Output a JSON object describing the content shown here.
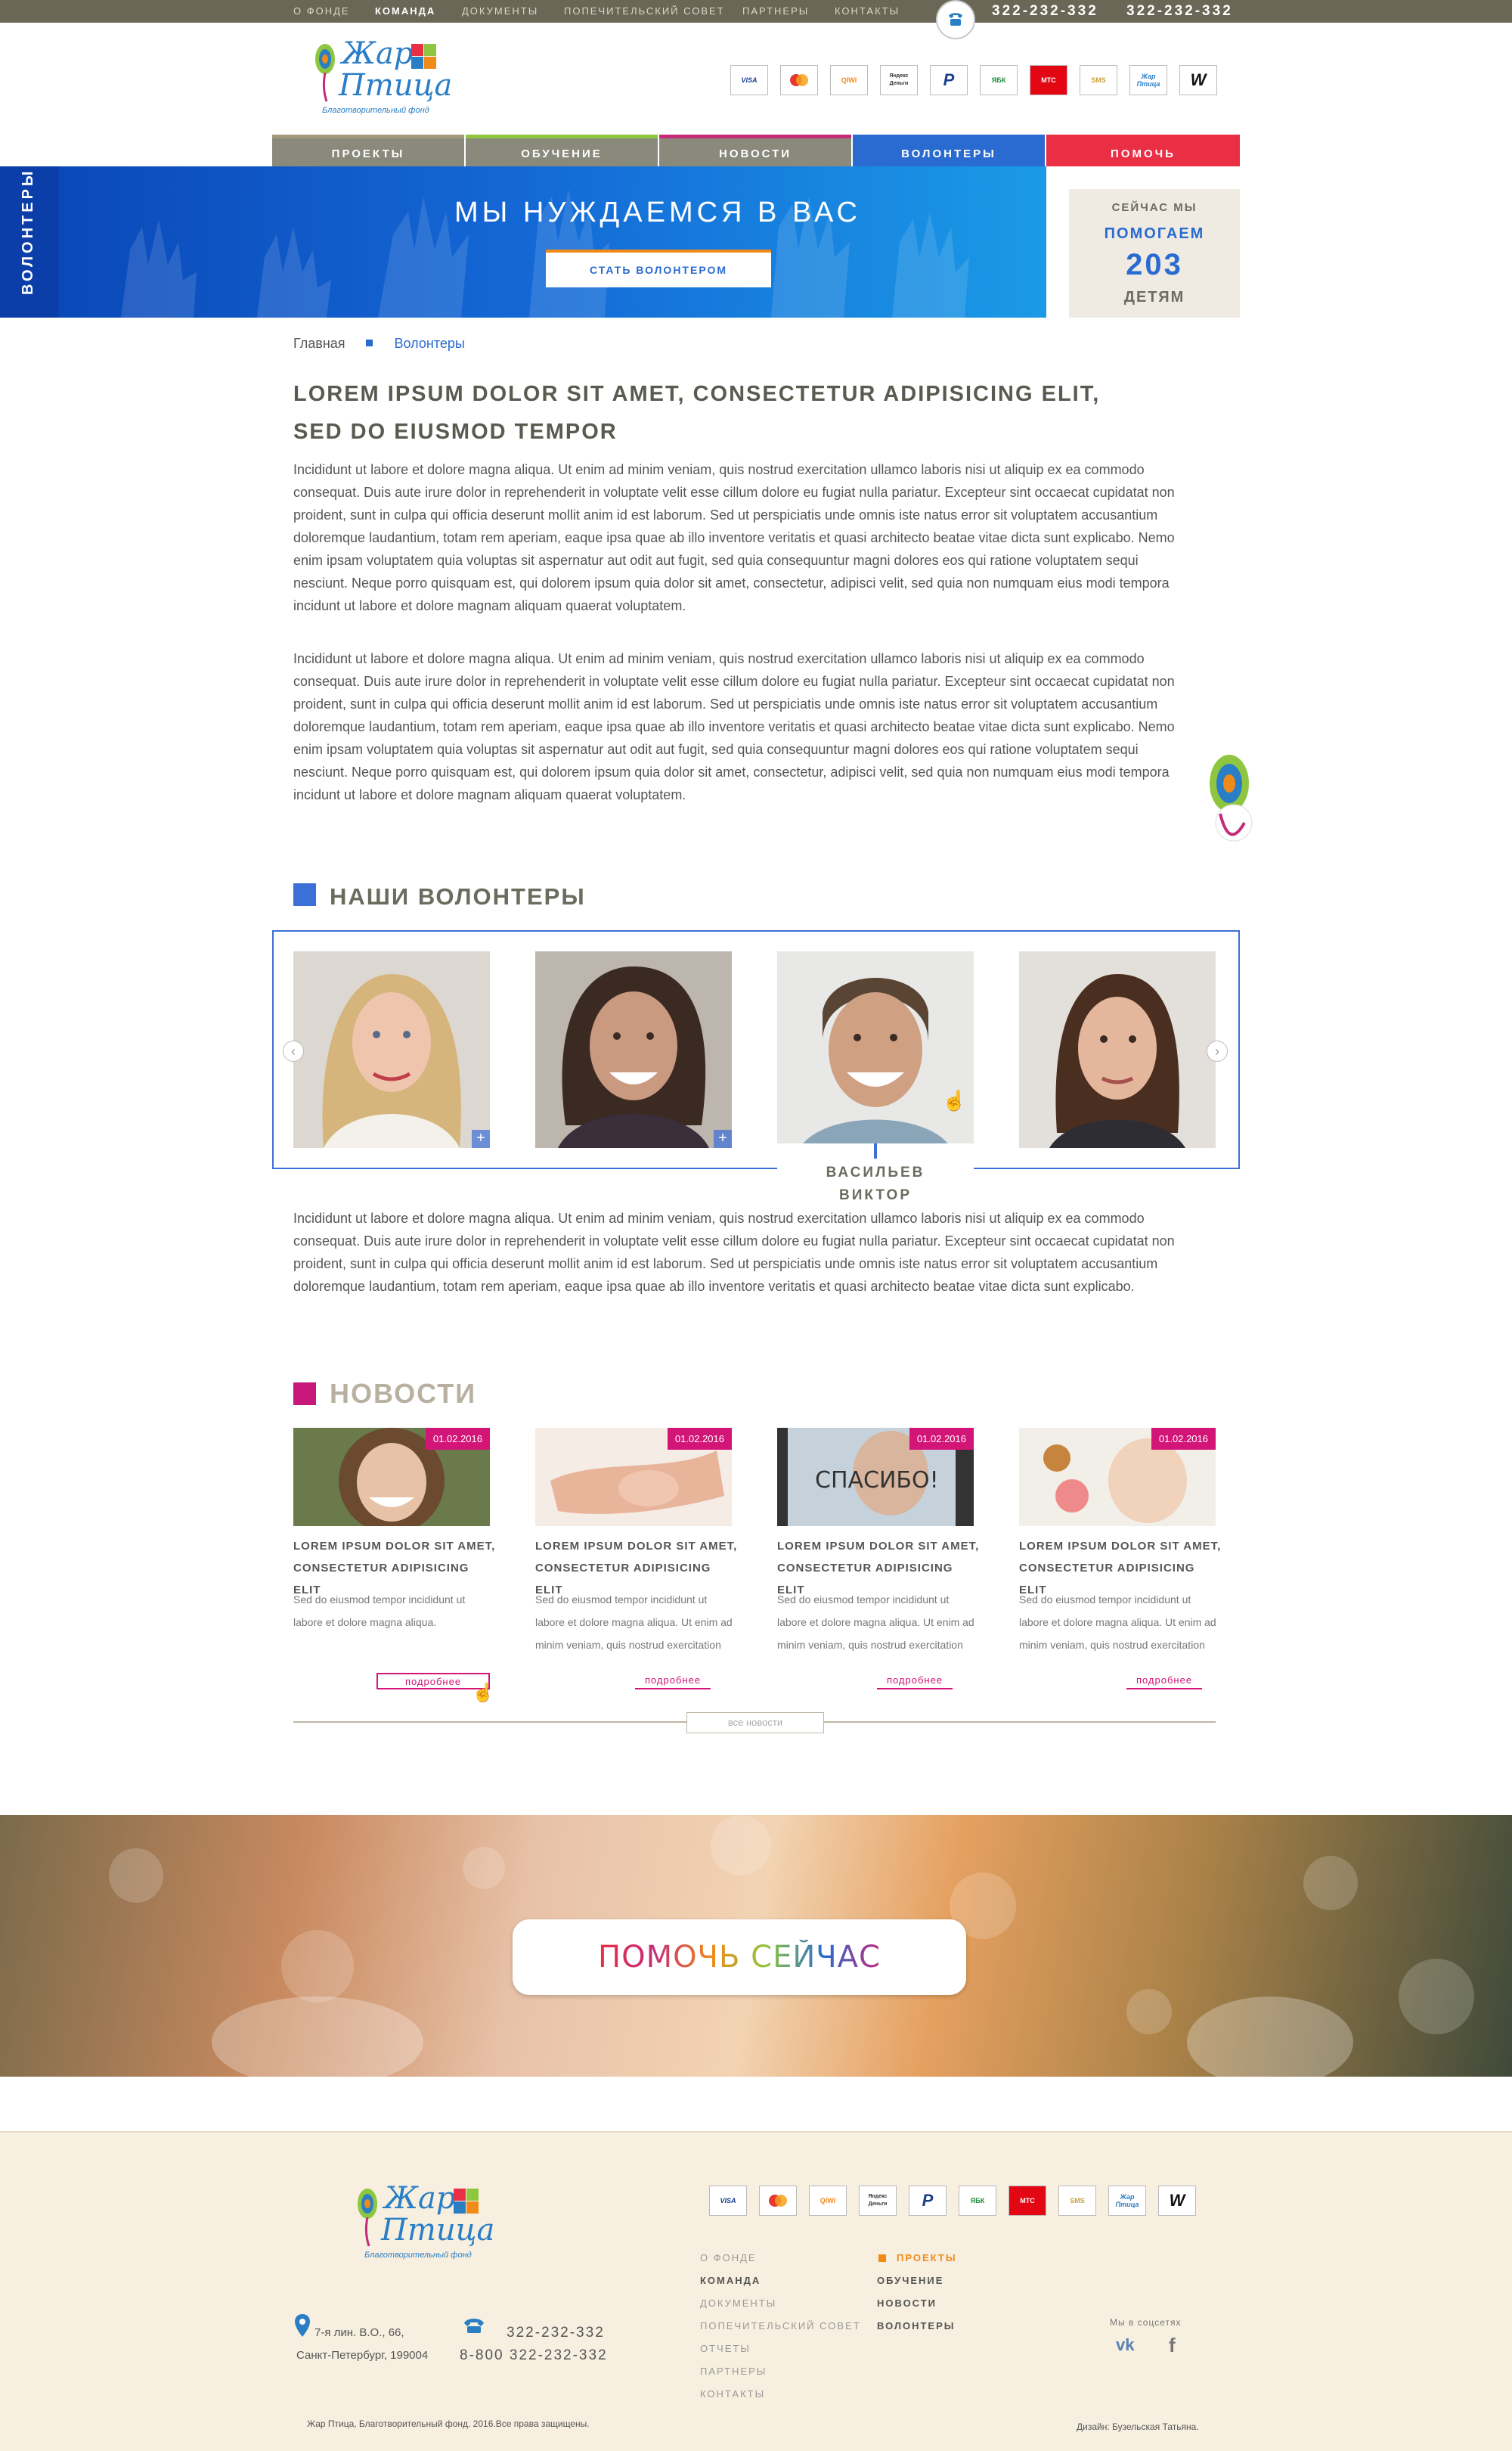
{
  "topnav": {
    "items": [
      "О ФОНДЕ",
      "КОМАНДА",
      "ДОКУМЕНТЫ",
      "ПОПЕЧИТЕЛЬСКИЙ СОВЕТ",
      "ПАРТНЕРЫ",
      "КОНТАКТЫ"
    ],
    "active": "КОМАНДА",
    "phone1": "322-232-332",
    "phone2": "322-232-332"
  },
  "logo": {
    "line1": "Жар",
    "line2": "Птица",
    "subtitle": "Благотворительный фонд"
  },
  "payments": [
    "VISA",
    "Maestro",
    "QIWI",
    "Яндекс Деньги",
    "PayPal",
    "ЯБК",
    "МТС",
    "SMS",
    "Жар Птица",
    "WebMoney"
  ],
  "mainnav": [
    {
      "label": "ПРОЕКТЫ",
      "color": "#8a8a7c",
      "border": "#a39a7a"
    },
    {
      "label": "ОБУЧЕНИЕ",
      "color": "#8a8a7c",
      "border": "#8ec63f"
    },
    {
      "label": "НОВОСТИ",
      "color": "#8a8a7c",
      "border": "#c42c7a"
    },
    {
      "label": "ВОЛОНТЕРЫ",
      "color": "#2a6bd1",
      "border": "#2a6bd1"
    },
    {
      "label": "ПОМОЧЬ",
      "color": "#ea2f45",
      "border": "#ea2f45"
    }
  ],
  "hero": {
    "side_label": "ВОЛОНТЕРЫ",
    "title": "МЫ НУЖДАЕМСЯ В ВАС",
    "button": "СТАТЬ ВОЛОНТЕРОМ"
  },
  "stats": {
    "line1": "СЕЙЧАС МЫ",
    "line2": "ПОМОГАЕМ",
    "number": "203",
    "line3": "ДЕТЯМ"
  },
  "breadcrumb": {
    "home": "Главная",
    "current": "Волонтеры"
  },
  "article": {
    "title_line1": "LOREM IPSUM DOLOR SIT AMET, CONSECTETUR ADIPISICING ELIT,",
    "title_line2": "SED DO EIUSMOD TEMPOR",
    "para1": "Incididunt ut labore et dolore magna aliqua. Ut enim ad minim veniam, quis nostrud exercitation ullamco laboris nisi ut aliquip ex ea commodo consequat. Duis aute irure dolor in reprehenderit in voluptate velit esse cillum dolore eu fugiat nulla pariatur. Excepteur sint occaecat cupidatat non proident, sunt in culpa qui officia deserunt mollit anim id est laborum. Sed ut perspiciatis unde omnis iste natus error sit voluptatem accusantium doloremque laudantium, totam rem aperiam, eaque ipsa quae ab illo inventore veritatis et quasi architecto beatae vitae dicta sunt explicabo. Nemo enim ipsam voluptatem quia voluptas sit aspernatur aut odit aut fugit, sed quia consequuntur magni dolores eos qui ratione voluptatem sequi nesciunt. Neque porro quisquam est, qui dolorem ipsum quia dolor sit amet, consectetur, adipisci velit, sed quia non numquam eius modi tempora incidunt ut labore et dolore magnam aliquam quaerat voluptatem.",
    "para2": "Incididunt ut labore et dolore magna aliqua. Ut enim ad minim veniam, quis nostrud exercitation ullamco laboris nisi ut aliquip ex ea commodo consequat. Duis aute irure dolor in reprehenderit in voluptate velit esse cillum dolore eu fugiat nulla pariatur. Excepteur sint occaecat cupidatat non proident, sunt in culpa qui officia deserunt mollit anim id est laborum. Sed ut perspiciatis unde omnis iste natus error sit voluptatem accusantium doloremque laudantium, totam rem aperiam, eaque ipsa quae ab illo inventore veritatis et quasi architecto beatae vitae dicta sunt explicabo. Nemo enim ipsam voluptatem quia voluptas sit aspernatur aut odit aut fugit, sed quia consequuntur magni dolores eos qui ratione voluptatem sequi nesciunt. Neque porro quisquam est, qui dolorem ipsum quia dolor sit amet, consectetur, adipisci velit, sed quia non numquam eius modi tempora incidunt ut labore et dolore magnam aliquam quaerat voluptatem."
  },
  "volunteers": {
    "heading": "НАШИ ВОЛОНТЕРЫ",
    "selected_name_line1": "ВАСИЛЬЕВ",
    "selected_name_line2": "ВИКТОР",
    "para": "Incididunt ut labore et dolore magna aliqua. Ut enim ad minim veniam, quis nostrud exercitation ullamco laboris nisi ut aliquip ex ea commodo consequat. Duis aute irure dolor in reprehenderit in voluptate velit esse cillum dolore eu fugiat nulla pariatur. Excepteur sint occaecat cupidatat non proident, sunt in culpa qui officia deserunt mollit anim id est laborum. Sed ut perspiciatis unde omnis iste natus error sit voluptatem accusantium doloremque laudantium, totam rem aperiam, eaque ipsa quae ab illo inventore veritatis et quasi architecto beatae vitae dicta sunt explicabo."
  },
  "news": {
    "heading": "НОВОСТИ",
    "items": [
      {
        "date": "01.02.2016",
        "title": "LOREM IPSUM DOLOR SIT AMET, CONSECTETUR ADIPISICING ELIT",
        "text": "Sed do eiusmod tempor incididunt ut labore et dolore magna aliqua.",
        "more": "подробнее"
      },
      {
        "date": "01.02.2016",
        "title": "LOREM IPSUM DOLOR SIT AMET, CONSECTETUR ADIPISICING ELIT",
        "text": "Sed do eiusmod tempor incididunt ut labore et dolore magna aliqua. Ut enim ad minim veniam, quis nostrud exercitation",
        "more": "подробнее"
      },
      {
        "date": "01.02.2016",
        "title": "LOREM IPSUM DOLOR SIT AMET, CONSECTETUR ADIPISICING ELIT",
        "text": "Sed do eiusmod tempor incididunt ut labore et dolore magna aliqua. Ut enim ad minim veniam, quis nostrud exercitation",
        "more": "подробнее"
      },
      {
        "date": "01.02.2016",
        "title": "LOREM IPSUM DOLOR SIT AMET, CONSECTETUR ADIPISICING ELIT",
        "text": "Sed do eiusmod tempor incididunt ut labore et dolore magna aliqua. Ut enim ad minim veniam, quis nostrud exercitation",
        "more": "подробнее"
      }
    ],
    "all_news": "все новости",
    "stamp_text": "СПАСИБО!"
  },
  "help_banner": {
    "button": "ПОМОЧЬ СЕЙЧАС"
  },
  "footer": {
    "col1": [
      "О ФОНДЕ",
      "КОМАНДА",
      "ДОКУМЕНТЫ",
      "ПОПЕЧИТЕЛЬСКИЙ СОВЕТ",
      "ОТЧЕТЫ",
      "ПАРТНЕРЫ",
      "КОНТАКТЫ"
    ],
    "col2": [
      "ПРОЕКТЫ",
      "ОБУЧЕНИЕ",
      "НОВОСТИ",
      "ВОЛОНТЕРЫ"
    ],
    "address_line1": "7-я лин. В.О., 66,",
    "address_line2": "Санкт-Петербург, 199004",
    "phone1": "322-232-332",
    "phone2": "8-800 322-232-332",
    "social_label": "Мы в соцсетях",
    "copyright": "Жар Птица, Благотворительный фонд. 2016.Все права защищены.",
    "designer": "Дизайн: Бузельская Татьяна."
  },
  "colors": {
    "accent_blue": "#2a6bd1",
    "accent_pink": "#d31578",
    "accent_red": "#ea2f45",
    "orange": "#f08a18"
  }
}
